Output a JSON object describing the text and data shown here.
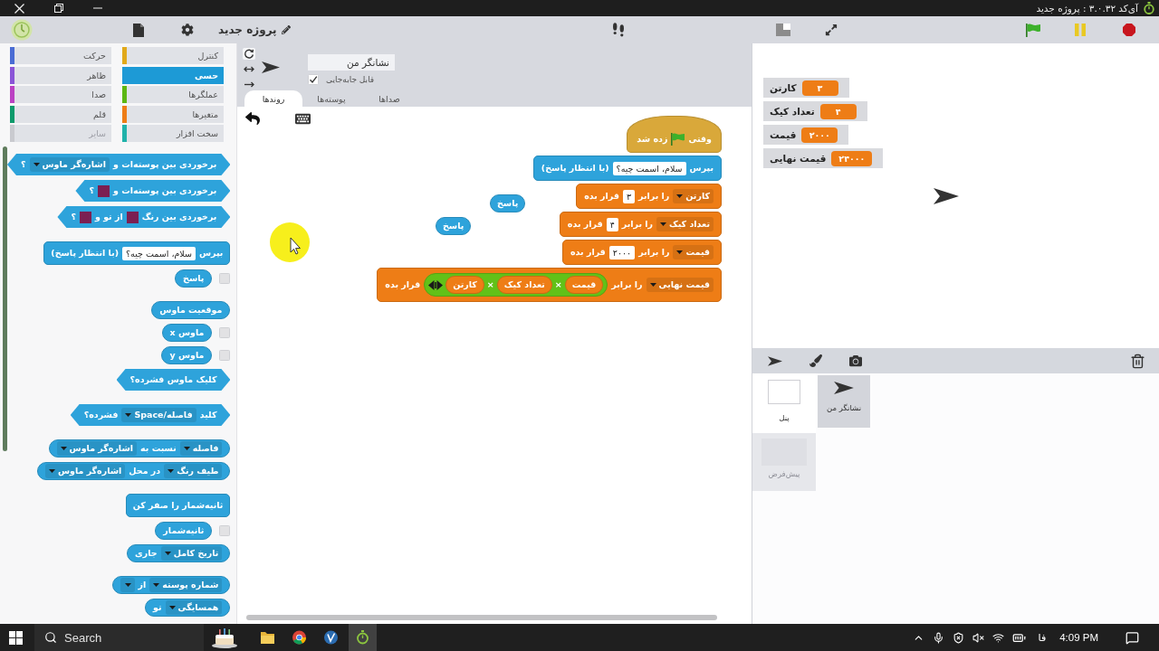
{
  "window": {
    "title": "آی‌کد ۳.۰.۳۲ : پروژه جدید"
  },
  "menu_bar": {
    "project_name": "پروژه جدید"
  },
  "palette": {
    "categories": [
      {
        "label": "کنترل",
        "color": "#e1a91a",
        "selected": false,
        "disabled": false
      },
      {
        "label": "حرکت",
        "color": "#4a6cd4",
        "selected": false,
        "disabled": false
      },
      {
        "label": "حسی",
        "color": "#1d9ad6",
        "selected": true,
        "disabled": false
      },
      {
        "label": "ظاهر",
        "color": "#8a55d7",
        "selected": false,
        "disabled": false
      },
      {
        "label": "عملگرها",
        "color": "#5cb712",
        "selected": false,
        "disabled": false
      },
      {
        "label": "صدا",
        "color": "#bb42c3",
        "selected": false,
        "disabled": false
      },
      {
        "label": "متغیرها",
        "color": "#ee7d16",
        "selected": false,
        "disabled": false
      },
      {
        "label": "قلم",
        "color": "#0e9a6c",
        "selected": false,
        "disabled": false
      },
      {
        "label": "سخت افزار",
        "color": "#20b2aa",
        "selected": false,
        "disabled": false
      },
      {
        "label": "سایر",
        "color": "#c9cacf",
        "selected": false,
        "disabled": true
      }
    ],
    "groups": [
      {
        "blocks": [
          {
            "kind": "boolean",
            "color": "#2ea3db",
            "parts": [
              {
                "kind": "text",
                "text": "برخوردی بین پوسته‌ات و"
              },
              {
                "kind": "dropdown",
                "text": "اشاره‌گر ماوس"
              },
              {
                "kind": "text",
                "text": "؟"
              }
            ]
          },
          {
            "kind": "boolean",
            "color": "#2ea3db",
            "parts": [
              {
                "kind": "text",
                "text": "برخوردی بین پوسته‌ات و"
              },
              {
                "kind": "swatch",
                "color": "#7b1f52"
              },
              {
                "kind": "text",
                "text": "؟"
              }
            ]
          },
          {
            "kind": "boolean",
            "color": "#2ea3db",
            "parts": [
              {
                "kind": "text",
                "text": "برخوردی بین رنگ"
              },
              {
                "kind": "swatch",
                "color": "#7b1f52"
              },
              {
                "kind": "text",
                "text": "از تو و"
              },
              {
                "kind": "swatch",
                "color": "#7b1f52"
              },
              {
                "kind": "text",
                "text": "؟"
              }
            ]
          }
        ]
      },
      {
        "blocks": [
          {
            "kind": "command",
            "color": "#2ea3db",
            "parts": [
              {
                "kind": "text",
                "text": "بپرس"
              },
              {
                "kind": "input",
                "text": "سلام، اسمت چیه؟"
              },
              {
                "kind": "text",
                "text": "(با انتظار پاسخ)"
              }
            ]
          },
          {
            "kind": "reporter",
            "color": "#2ea3db",
            "checkbox": {
              "checked": false
            },
            "parts": [
              {
                "kind": "text",
                "text": "پاسخ"
              }
            ]
          }
        ]
      },
      {
        "blocks": [
          {
            "kind": "reporter",
            "color": "#2ea3db",
            "parts": [
              {
                "kind": "text",
                "text": "موقعیت ماوس"
              }
            ]
          },
          {
            "kind": "reporter",
            "color": "#2ea3db",
            "checkbox": {
              "checked": false
            },
            "parts": [
              {
                "kind": "text",
                "text": "ماوس x"
              }
            ]
          },
          {
            "kind": "reporter",
            "color": "#2ea3db",
            "checkbox": {
              "checked": false
            },
            "parts": [
              {
                "kind": "text",
                "text": "ماوس y"
              }
            ]
          },
          {
            "kind": "boolean",
            "color": "#2ea3db",
            "parts": [
              {
                "kind": "text",
                "text": "کلیک ماوس فشرده؟"
              }
            ]
          }
        ]
      },
      {
        "blocks": [
          {
            "kind": "boolean",
            "color": "#2ea3db",
            "parts": [
              {
                "kind": "text",
                "text": "کلید"
              },
              {
                "kind": "dropdown",
                "text": "فاصله/Space"
              },
              {
                "kind": "text",
                "text": "فشرده؟"
              }
            ]
          }
        ]
      },
      {
        "blocks": [
          {
            "kind": "reporter",
            "color": "#2ea3db",
            "parts": [
              {
                "kind": "dropdown",
                "text": "فاصله"
              },
              {
                "kind": "text",
                "text": "نسبت به"
              },
              {
                "kind": "dropdown",
                "text": "اشاره‌گر ماوس"
              }
            ]
          },
          {
            "kind": "reporter",
            "color": "#2ea3db",
            "parts": [
              {
                "kind": "dropdown",
                "text": "طیف رنگ"
              },
              {
                "kind": "text",
                "text": "در محل"
              },
              {
                "kind": "dropdown",
                "text": "اشاره‌گر ماوس"
              }
            ]
          }
        ]
      },
      {
        "blocks": [
          {
            "kind": "command",
            "color": "#2ea3db",
            "parts": [
              {
                "kind": "text",
                "text": "ثانیه‌شمار را صفر کن"
              }
            ]
          },
          {
            "kind": "reporter",
            "color": "#2ea3db",
            "checkbox": {
              "checked": false
            },
            "parts": [
              {
                "kind": "text",
                "text": "ثانیه‌شمار"
              }
            ]
          },
          {
            "kind": "reporter",
            "color": "#2ea3db",
            "parts": [
              {
                "kind": "dropdown",
                "text": "تاریخ کامل"
              },
              {
                "kind": "text",
                "text": "جاری"
              }
            ]
          }
        ]
      },
      {
        "blocks": [
          {
            "kind": "reporter",
            "color": "#2ea3db",
            "parts": [
              {
                "kind": "dropdown",
                "text": "شماره پوسته"
              },
              {
                "kind": "text",
                "text": "از"
              },
              {
                "kind": "dropdown"
              }
            ]
          },
          {
            "kind": "reporter",
            "color": "#2ea3db",
            "parts": [
              {
                "kind": "dropdown",
                "text": "همسایگی"
              },
              {
                "kind": "text",
                "text": "تو"
              }
            ]
          }
        ]
      }
    ]
  },
  "sprite": {
    "name": "نشانگر من",
    "draggable": {
      "label": "قابل جابه‌جایی",
      "checked": true
    },
    "rotation_styles": [
      {
        "kind": "rotate",
        "selected": true
      },
      {
        "kind": "flip",
        "selected": false
      },
      {
        "kind": "none",
        "selected": false
      }
    ]
  },
  "editor": {
    "tabs": [
      {
        "label": "صداها",
        "selected": false
      },
      {
        "label": "پوسته‌ها",
        "selected": false
      },
      {
        "label": "روندها",
        "selected": true
      }
    ],
    "scripts": [
      {
        "blocks": [
          {
            "kind": "hat",
            "color": "#d9a83a",
            "parts": [
              {
                "kind": "text",
                "text": "وقتی"
              },
              {
                "kind": "flag"
              },
              {
                "kind": "text",
                "text": "زده شد"
              }
            ]
          },
          {
            "kind": "command",
            "color": "#2ea3db",
            "parts": [
              {
                "kind": "text",
                "text": "بپرس"
              },
              {
                "kind": "input",
                "text": "سلام، اسمت چیه؟"
              },
              {
                "kind": "text",
                "text": "(با انتظار پاسخ)"
              }
            ]
          },
          {
            "kind": "command",
            "color": "#ee7d16",
            "parts": [
              {
                "kind": "dropdown",
                "text": "کارتن"
              },
              {
                "kind": "text",
                "text": "را برابر"
              },
              {
                "kind": "input",
                "text": "۳"
              },
              {
                "kind": "text",
                "text": "قرار بده"
              }
            ]
          },
          {
            "kind": "command",
            "color": "#ee7d16",
            "parts": [
              {
                "kind": "dropdown",
                "text": "تعداد کیک"
              },
              {
                "kind": "text",
                "text": "را برابر"
              },
              {
                "kind": "input",
                "text": "۴"
              },
              {
                "kind": "text",
                "text": "قرار بده"
              }
            ]
          },
          {
            "kind": "command",
            "color": "#ee7d16",
            "parts": [
              {
                "kind": "dropdown",
                "text": "قیمت"
              },
              {
                "kind": "text",
                "text": "را برابر"
              },
              {
                "kind": "input",
                "text": "۲۰۰۰"
              },
              {
                "kind": "text",
                "text": "قرار بده"
              }
            ]
          },
          {
            "kind": "command",
            "color": "#ee7d16",
            "parts": [
              {
                "kind": "dropdown",
                "text": "قیمت نهایی"
              },
              {
                "kind": "text",
                "text": "را برابر"
              },
              {
                "kind": "operator",
                "color": "#62c118",
                "parts": [
                  {
                    "kind": "variable",
                    "color": "#ee7d16",
                    "text": "قیمت"
                  },
                  {
                    "kind": "text",
                    "text": "×"
                  },
                  {
                    "kind": "variable",
                    "color": "#ee7d16",
                    "text": "تعداد کیک"
                  },
                  {
                    "kind": "text",
                    "text": "×"
                  },
                  {
                    "kind": "variable",
                    "color": "#ee7d16",
                    "text": "کارتن"
                  },
                  {
                    "kind": "arrows"
                  }
                ]
              },
              {
                "kind": "text",
                "text": "قرار بده"
              }
            ]
          }
        ]
      },
      {
        "blocks": [
          {
            "kind": "reporter",
            "color": "#2ea3db",
            "parts": [
              {
                "kind": "text",
                "text": "پاسخ"
              }
            ]
          }
        ]
      },
      {
        "blocks": [
          {
            "kind": "reporter",
            "color": "#2ea3db",
            "parts": [
              {
                "kind": "text",
                "text": "پاسخ"
              }
            ]
          }
        ]
      }
    ]
  },
  "stage": {
    "monitors": [
      {
        "label": "کارتن",
        "value": "۳"
      },
      {
        "label": "تعداد کیک",
        "value": "۴"
      },
      {
        "label": "قیمت",
        "value": "۲۰۰۰"
      },
      {
        "label": "قیمت نهایی",
        "value": "۲۴۰۰۰"
      }
    ]
  },
  "sprite_corral": {
    "stage": {
      "label": "پنل"
    },
    "backdrop": {
      "label": "پیش‌فرض"
    },
    "sprites": [
      {
        "label": "نشانگر من",
        "selected": true
      }
    ]
  },
  "taskbar": {
    "search": {
      "placeholder": "Search"
    },
    "apps": [
      {
        "kind": "folder",
        "selected": false
      },
      {
        "kind": "browser",
        "selected": false
      },
      {
        "kind": "circle",
        "selected": false
      },
      {
        "kind": "stopwatch",
        "selected": true
      }
    ],
    "language": "فا",
    "time": "4:09 PM"
  }
}
